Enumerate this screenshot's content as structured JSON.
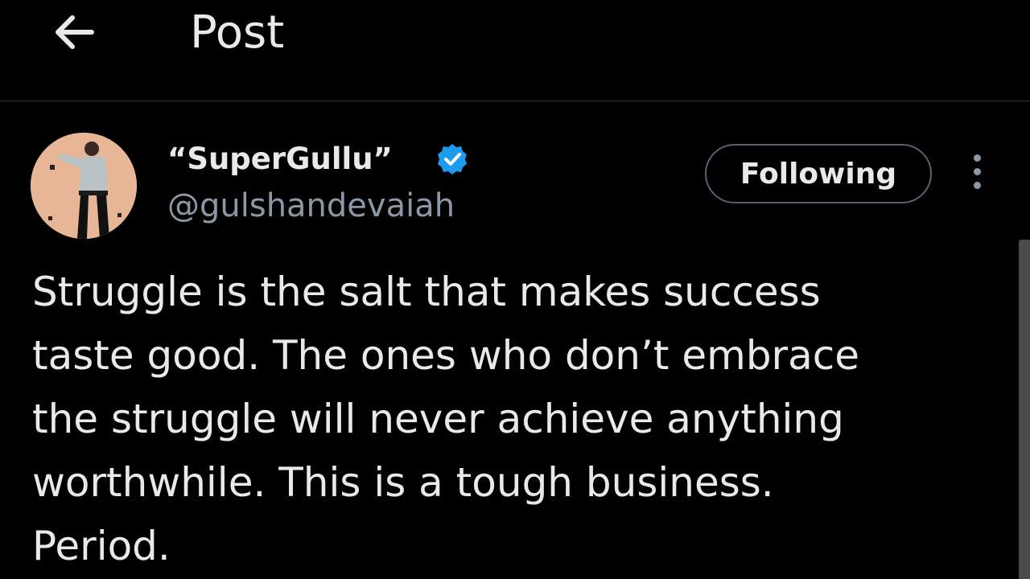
{
  "header": {
    "title": "Post",
    "back_icon": "arrow-left-icon"
  },
  "author": {
    "display_name": "“SuperGullu”",
    "handle": "@gulshandevaiah",
    "verified_icon": "verified-badge-icon",
    "verified_color": "#1d9bf0"
  },
  "actions": {
    "follow_label": "Following",
    "more_icon": "more-vertical-icon"
  },
  "post": {
    "text": "Struggle is the salt that makes success\ntaste good. The ones who don’t embrace\nthe struggle will never achieve anything\nworthwhile. This is a tough business.\nPeriod."
  },
  "colors": {
    "background": "#000000",
    "text_primary": "#e7e9ea",
    "text_secondary": "#8b98a5",
    "accent": "#1d9bf0"
  }
}
